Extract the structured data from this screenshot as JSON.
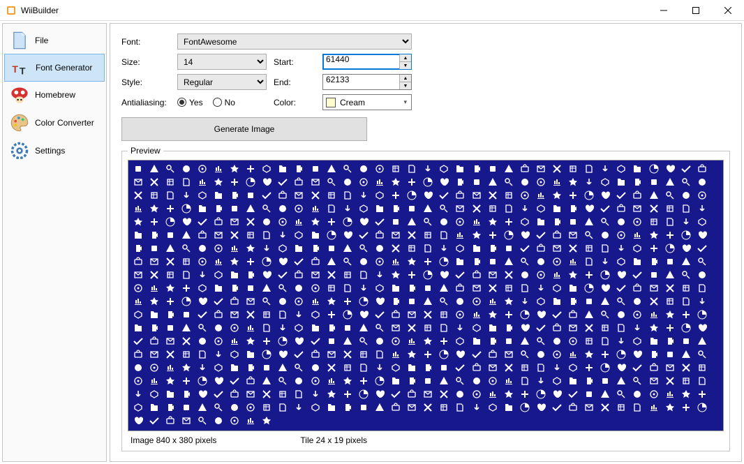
{
  "window": {
    "title": "WiiBuilder"
  },
  "sidebar": {
    "items": [
      {
        "label": "File",
        "icon": "file"
      },
      {
        "label": "Font Generator",
        "icon": "font"
      },
      {
        "label": "Homebrew",
        "icon": "mushroom"
      },
      {
        "label": "Color Converter",
        "icon": "palette"
      },
      {
        "label": "Settings",
        "icon": "gear"
      }
    ],
    "selected": 1
  },
  "form": {
    "font_label": "Font:",
    "font_value": "FontAwesome",
    "size_label": "Size:",
    "size_value": "14",
    "start_label": "Start:",
    "start_value": "61440",
    "style_label": "Style:",
    "style_value": "Regular",
    "end_label": "End:",
    "end_value": "62133",
    "aa_label": "Antialiasing:",
    "aa_yes": "Yes",
    "aa_no": "No",
    "aa_value": "Yes",
    "color_label": "Color:",
    "color_value": "Cream",
    "color_hex": "#fffdd0"
  },
  "generate_button": "Generate Image",
  "preview": {
    "legend": "Preview",
    "bg_color": "#17188c",
    "fg_color": "#ffffff",
    "glyph_count": 693,
    "image_info": "Image 840 x 380 pixels",
    "tile_info": "Tile 24 x 19 pixels"
  }
}
